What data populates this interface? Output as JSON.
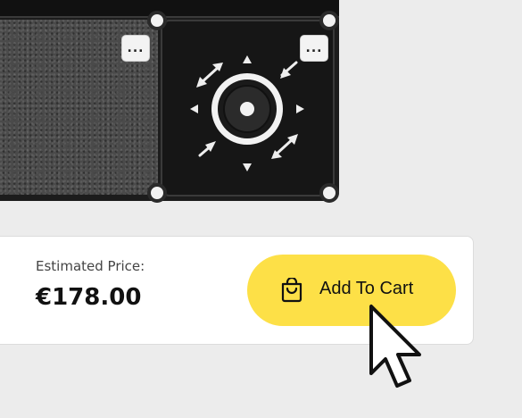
{
  "preview": {
    "texture_menu_label": "...",
    "knob_menu_label": "..."
  },
  "pricing": {
    "label": "Estimated Price:",
    "value": "€178.00"
  },
  "cart_button": {
    "label": "Add To Cart"
  },
  "colors": {
    "accent": "#fde047",
    "background": "#ececec"
  }
}
